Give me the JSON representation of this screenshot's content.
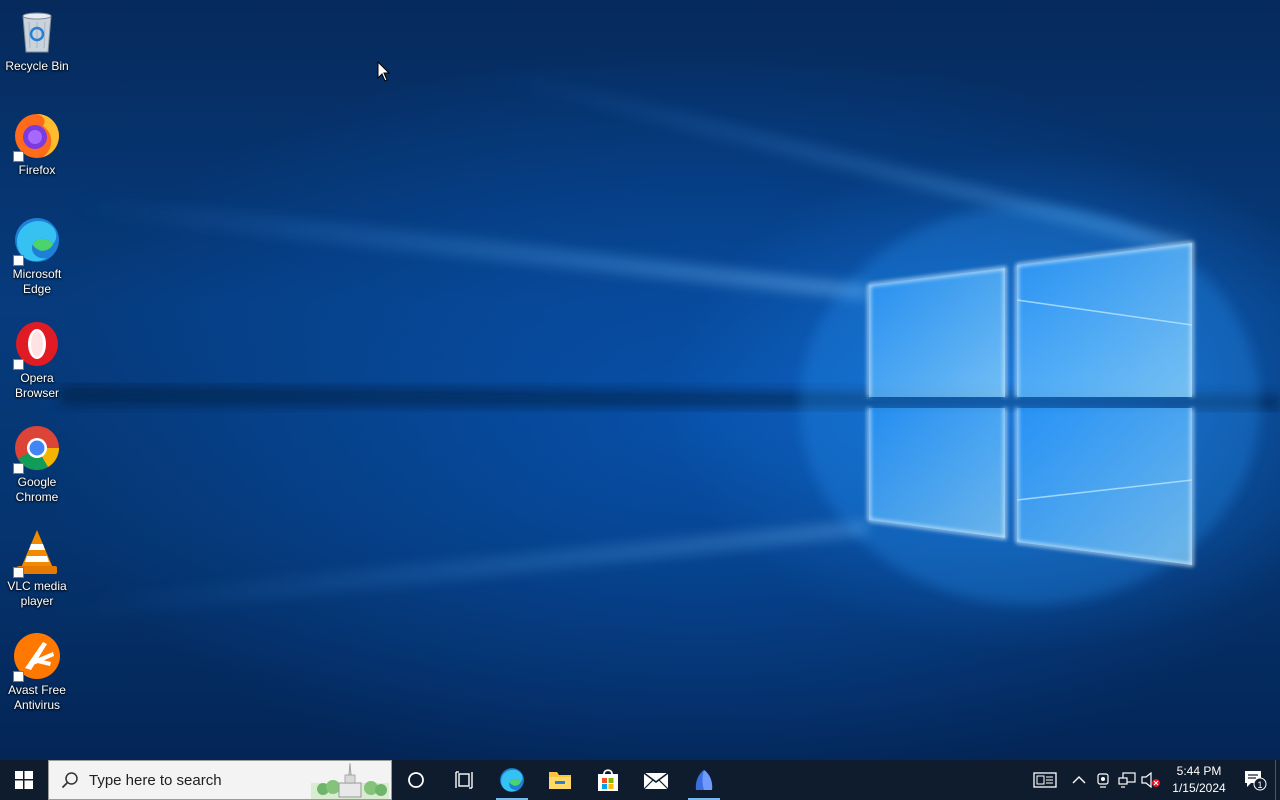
{
  "desktop": {
    "icons": [
      {
        "label": "Recycle Bin",
        "icon": "recycle-bin-icon"
      },
      {
        "label": "Firefox",
        "icon": "firefox-icon"
      },
      {
        "label": "Microsoft Edge",
        "icon": "edge-icon"
      },
      {
        "label": "Opera Browser",
        "icon": "opera-icon"
      },
      {
        "label": "Google Chrome",
        "icon": "chrome-icon"
      },
      {
        "label": "VLC media player",
        "icon": "vlc-icon"
      },
      {
        "label": "Avast Free Antivirus",
        "icon": "avast-icon"
      }
    ]
  },
  "taskbar": {
    "search_placeholder": "Type here to search",
    "pinned": [
      "cortana-icon",
      "task-view-icon",
      "edge-icon",
      "file-explorer-icon",
      "microsoft-store-icon",
      "mail-icon",
      "app-icon"
    ],
    "active_app": "edge-icon"
  },
  "tray": {
    "icons": [
      "news-icon",
      "show-hidden-icon",
      "meet-now-icon",
      "network-icon",
      "volume-muted-icon"
    ],
    "time": "5:44 PM",
    "date": "1/15/2024",
    "notification_count": "1"
  },
  "colors": {
    "taskbar": "#0f1c2e",
    "accent": "#76b9ed",
    "wallpaper": "#063b7d"
  }
}
